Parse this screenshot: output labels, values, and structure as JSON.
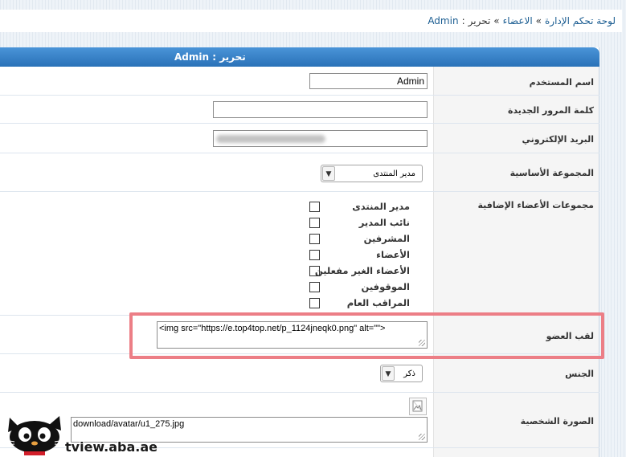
{
  "breadcrumb": {
    "home": "لوحة تحكم الإدارة",
    "members": "الاعضاء",
    "edit": "تحرير",
    "user": "Admin",
    "separator": "»",
    "colon": ":"
  },
  "panel": {
    "title": "تحرير : Admin"
  },
  "fields": {
    "username": {
      "label": "اسم المستخدم",
      "value": "Admin"
    },
    "new_password": {
      "label": "كلمة المرور الجديدة",
      "value": ""
    },
    "email": {
      "label": "البريد الإلكتروني"
    },
    "main_group": {
      "label": "المجموعة الأساسية",
      "value": "مدير المنتدى"
    },
    "extra_groups": {
      "label": "مجموعات الأعضاء الإضافية",
      "items": [
        {
          "label": "مدير المنتدى",
          "checked": false
        },
        {
          "label": "نائب المدير",
          "checked": false
        },
        {
          "label": "المشرفين",
          "checked": false
        },
        {
          "label": "الأعضاء",
          "checked": false
        },
        {
          "label": "الأعضاء الغير مفعلين",
          "checked": false
        },
        {
          "label": "الموقوفين",
          "checked": false
        },
        {
          "label": "المراقب العام",
          "checked": false
        }
      ]
    },
    "member_title": {
      "label": "لقب العضو",
      "value": "<img src=\"https://e.top4top.net/p_1124jneqk0.png\" alt=\"\">"
    },
    "gender": {
      "label": "الجنس",
      "value": "ذكر"
    },
    "avatar": {
      "label": "الصورة الشخصية",
      "value": "download/avatar/u1_275.jpg"
    }
  },
  "watermark": {
    "text": "tview.aba.ae"
  },
  "colors": {
    "header_top": "#4a94d8",
    "header_bottom": "#2a72b8",
    "highlight": "#ec7e86",
    "link": "#1a5c91"
  },
  "icons": {
    "select_arrow": "chevron-down-icon",
    "avatar_preview": "image-placeholder-icon",
    "mascot": "black-cat-icon"
  }
}
